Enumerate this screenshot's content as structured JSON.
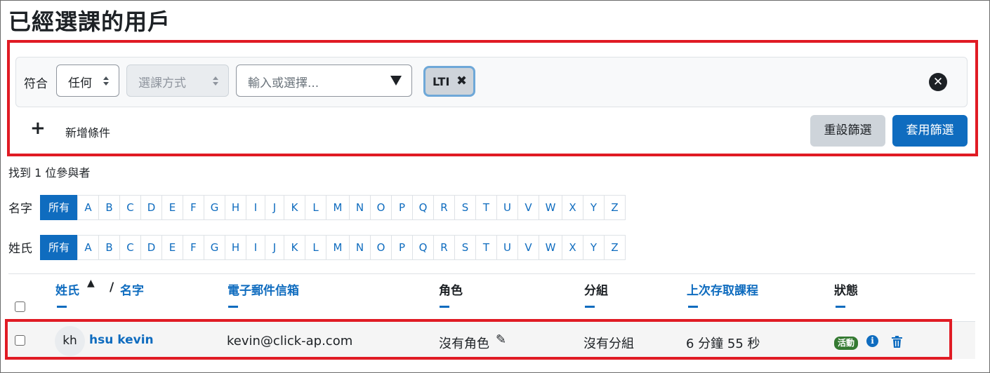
{
  "page": {
    "title": "已經選課的用戶"
  },
  "filter": {
    "match_label": "符合",
    "match_value": "任何",
    "type_value": "選課方式",
    "search_placeholder": "輸入或選擇...",
    "tag_label": "LTI",
    "add_condition": "新增條件",
    "reset_button": "重設篩選",
    "apply_button": "套用篩選"
  },
  "summary": {
    "found_text": "找到 1 位參與者"
  },
  "initials": {
    "firstname_label": "名字",
    "lastname_label": "姓氏",
    "letters": [
      "所有",
      "A",
      "B",
      "C",
      "D",
      "E",
      "F",
      "G",
      "H",
      "I",
      "J",
      "K",
      "L",
      "M",
      "N",
      "O",
      "P",
      "Q",
      "R",
      "S",
      "T",
      "U",
      "V",
      "W",
      "X",
      "Y",
      "Z"
    ]
  },
  "table": {
    "headers": {
      "lastname": "姓氏",
      "slash": "/",
      "firstname": "名字",
      "email": "電子郵件信箱",
      "role": "角色",
      "groups": "分組",
      "last_access": "上次存取課程",
      "status": "狀態"
    },
    "rows": [
      {
        "initials": "kh",
        "name": "hsu kevin",
        "email": "kevin@click-ap.com",
        "role": "沒有角色",
        "groups": "沒有分組",
        "last_access": "6 分鐘 55 秒",
        "status": "活動"
      }
    ]
  },
  "colors": {
    "accent": "#0f6cbf",
    "highlight": "#e01b24",
    "active_badge": "#357a32"
  }
}
